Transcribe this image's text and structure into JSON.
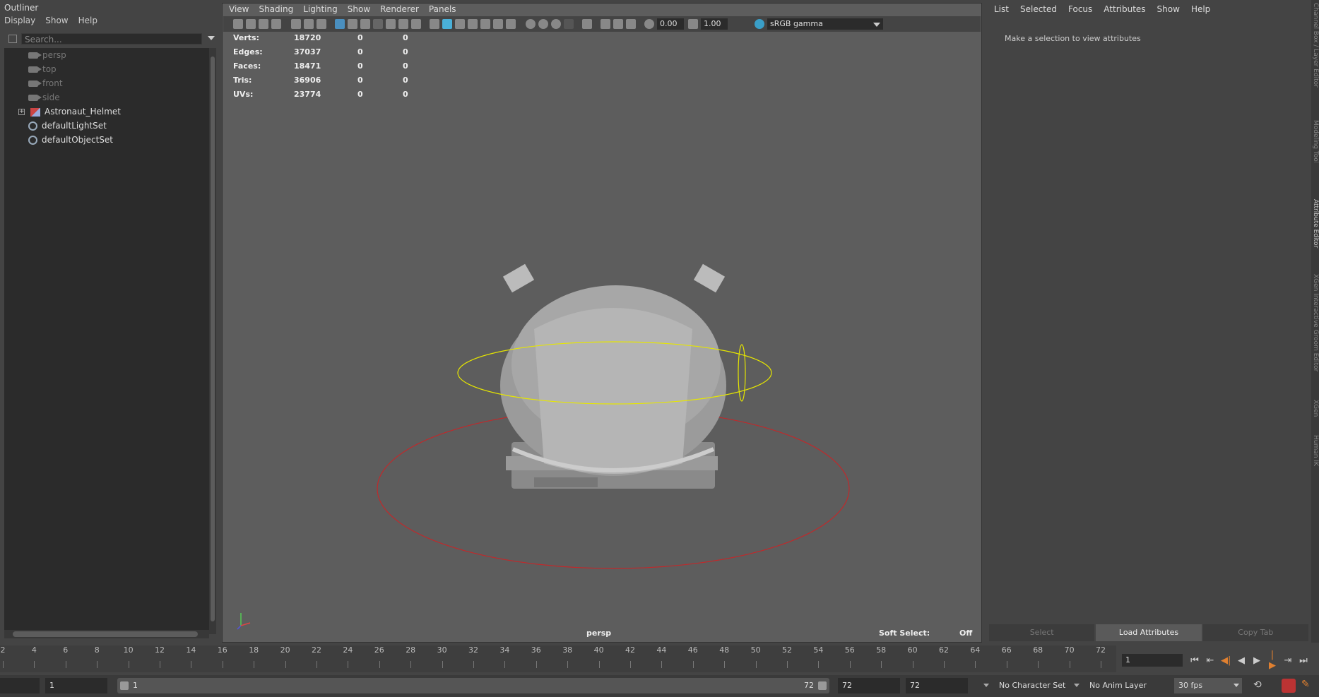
{
  "outliner": {
    "title": "Outliner",
    "menu": [
      "Display",
      "Show",
      "Help"
    ],
    "search_placeholder": "Search...",
    "items": [
      {
        "label": "persp",
        "type": "camera",
        "dim": true
      },
      {
        "label": "top",
        "type": "camera",
        "dim": true
      },
      {
        "label": "front",
        "type": "camera",
        "dim": true
      },
      {
        "label": "side",
        "type": "camera",
        "dim": true
      },
      {
        "label": "Astronaut_Helmet",
        "type": "mesh",
        "dim": false,
        "expandable": true
      },
      {
        "label": "defaultLightSet",
        "type": "set",
        "dim": false
      },
      {
        "label": "defaultObjectSet",
        "type": "set",
        "dim": false
      }
    ]
  },
  "viewport": {
    "menu": [
      "View",
      "Shading",
      "Lighting",
      "Show",
      "Renderer",
      "Panels"
    ],
    "toolbar": {
      "exposure": "0.00",
      "gamma": "1.00",
      "color_space": "sRGB gamma"
    },
    "hud": [
      {
        "label": "Verts:",
        "v1": "18720",
        "v2": "0",
        "v3": "0"
      },
      {
        "label": "Edges:",
        "v1": "37037",
        "v2": "0",
        "v3": "0"
      },
      {
        "label": "Faces:",
        "v1": "18471",
        "v2": "0",
        "v3": "0"
      },
      {
        "label": "Tris:",
        "v1": "36906",
        "v2": "0",
        "v3": "0"
      },
      {
        "label": "UVs:",
        "v1": "23774",
        "v2": "0",
        "v3": "0"
      }
    ],
    "camera": "persp",
    "soft_select_label": "Soft Select:",
    "soft_select_value": "Off",
    "colors": {
      "background": "#5d5d5d",
      "selection_ring": "#e6e600",
      "ground_ring": "#c0292b"
    }
  },
  "attribute_editor": {
    "menu": [
      "List",
      "Selected",
      "Focus",
      "Attributes",
      "Show",
      "Help"
    ],
    "message": "Make a selection to view attributes",
    "buttons": {
      "select": "Select",
      "load": "Load Attributes",
      "copy": "Copy Tab"
    },
    "side_tabs": [
      "Channel Box / Layer Editor",
      "Modeling Toolkit",
      "Attribute Editor",
      "XGen Interactive Groom Editor",
      "XGen",
      "Human IK"
    ]
  },
  "timeline": {
    "ticks": [
      "2",
      "4",
      "6",
      "8",
      "10",
      "12",
      "14",
      "16",
      "18",
      "20",
      "22",
      "24",
      "26",
      "28",
      "30",
      "32",
      "34",
      "36",
      "38",
      "40",
      "42",
      "44",
      "46",
      "48",
      "50",
      "52",
      "54",
      "56",
      "58",
      "60",
      "62",
      "64",
      "66",
      "68",
      "70",
      "72"
    ],
    "current_frame": "1"
  },
  "range": {
    "start_field": "1",
    "slider_start": "1",
    "slider_end": "72",
    "end_field": "72",
    "end_field2": "72",
    "character_set": "No Character Set",
    "anim_layer": "No Anim Layer",
    "fps": "30 fps"
  }
}
